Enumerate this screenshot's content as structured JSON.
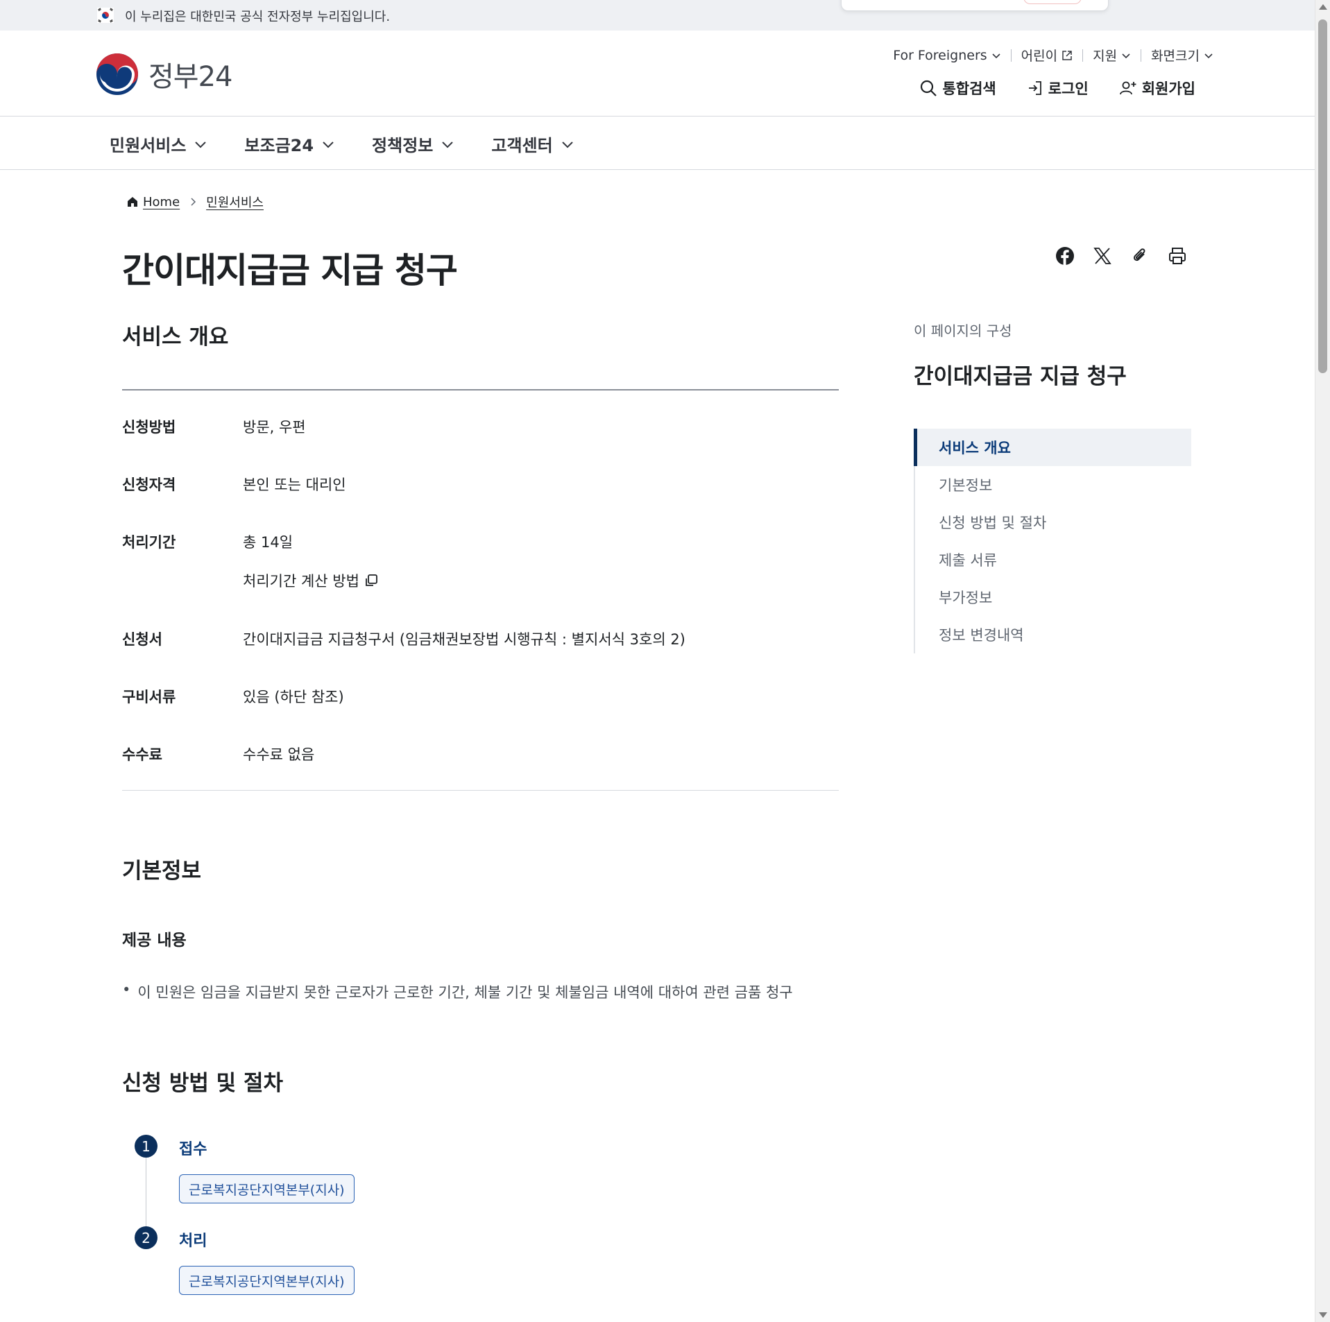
{
  "gov_banner": {
    "text": "이 누리집은 대한민국 공식 전자정부 누리집입니다.",
    "flag_icon": "korea-flag-icon"
  },
  "header": {
    "logo_text": "정부24",
    "utility_nav": [
      {
        "label": "For Foreigners",
        "icon": "chevron-down-icon"
      },
      {
        "label": "어린이",
        "icon": "external-link-icon"
      },
      {
        "label": "지원",
        "icon": "chevron-down-icon"
      },
      {
        "label": "화면크기",
        "icon": "chevron-down-icon"
      }
    ],
    "actions": [
      {
        "label": "통합검색",
        "icon": "search-icon"
      },
      {
        "label": "로그인",
        "icon": "login-icon"
      },
      {
        "label": "회원가입",
        "icon": "user-add-icon"
      }
    ]
  },
  "gnb": {
    "items": [
      {
        "label": "민원서비스"
      },
      {
        "label": "보조금24"
      },
      {
        "label": "정책정보"
      },
      {
        "label": "고객센터"
      }
    ]
  },
  "breadcrumb": {
    "home": "Home",
    "current": "민원서비스"
  },
  "page_title": "간이대지급금 지급 청구",
  "share_tools": [
    "facebook-icon",
    "x-icon",
    "paperclip-icon",
    "print-icon"
  ],
  "overview": {
    "heading": "서비스 개요",
    "rows": [
      {
        "label": "신청방법",
        "value": "방문, 우편"
      },
      {
        "label": "신청자격",
        "value": "본인 또는 대리인"
      },
      {
        "label": "처리기간",
        "value": "총 14일",
        "link": "처리기간 계산 방법"
      },
      {
        "label": "신청서",
        "value": "간이대지급금 지급청구서 (임금채권보장법 시행규칙 : 별지서식 3호의 2)"
      },
      {
        "label": "구비서류",
        "value": "있음 (하단 참조)"
      },
      {
        "label": "수수료",
        "value": "수수료 없음"
      }
    ]
  },
  "basic_info": {
    "heading": "기본정보",
    "sub_heading": "제공 내용",
    "bullet": "이 민원은 임금을 지급받지 못한 근로자가 근로한 기간, 체불 기간 및 체불임금 내역에 대하여 관련 금품 청구"
  },
  "procedure": {
    "heading": "신청 방법 및 절차",
    "steps": [
      {
        "num": "1",
        "title": "접수",
        "org": "근로복지공단지역본부(지사)"
      },
      {
        "num": "2",
        "title": "처리",
        "org": "근로복지공단지역본부(지사)"
      }
    ]
  },
  "toc": {
    "caption": "이 페이지의 구성",
    "title": "간이대지급금 지급 청구",
    "items": [
      {
        "label": "서비스 개요",
        "active": true
      },
      {
        "label": "기본정보"
      },
      {
        "label": "신청 방법 및 절차"
      },
      {
        "label": "제출 서류"
      },
      {
        "label": "부가정보"
      },
      {
        "label": "정보 변경내역"
      }
    ]
  },
  "colors": {
    "primary_navy": "#0b2f5c",
    "link_blue": "#0b3b79",
    "emblem_red": "#cd2e3a",
    "emblem_blue": "#0f3a7a"
  }
}
